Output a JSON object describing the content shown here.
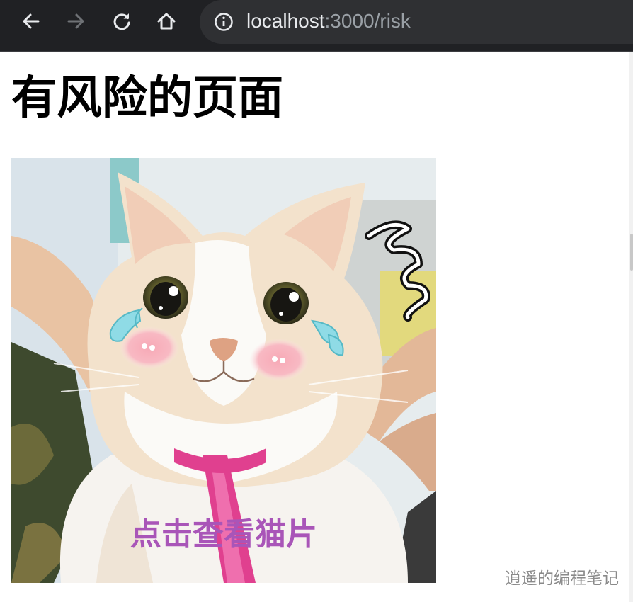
{
  "browser": {
    "url_host": "localhost",
    "url_path": ":3000/risk",
    "icons": [
      "back-arrow-icon",
      "forward-arrow-icon",
      "reload-icon",
      "home-icon",
      "site-info-icon"
    ]
  },
  "page": {
    "title": "有风险的页面",
    "link_text": "点击查看猫片",
    "watermark": "逍遥的编程笔记"
  },
  "colors": {
    "browser_bar": "#202124",
    "url_box": "#2f3033",
    "link": "#a955b8",
    "watermark": "#8a8a8a"
  }
}
